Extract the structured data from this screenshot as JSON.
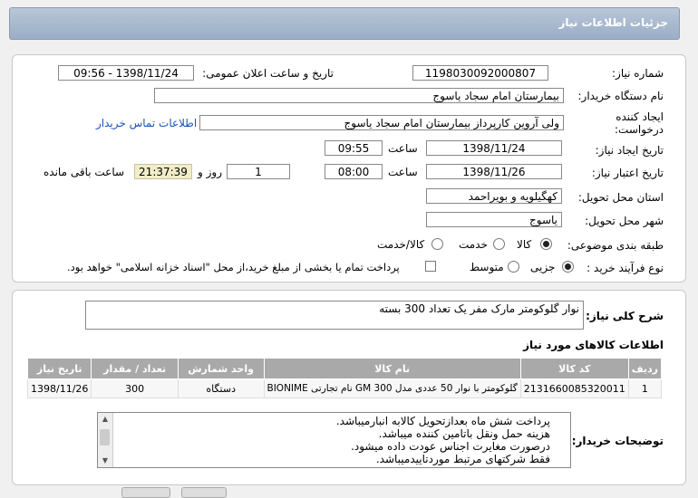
{
  "header": {
    "title": "جزئیات اطلاعات نیاز"
  },
  "form": {
    "need_number_label": "شماره نیاز:",
    "need_number": "1198030092000807",
    "announce_label": "تاریخ و ساعت اعلان عمومی:",
    "announce_value": "1398/11/24 - 09:56",
    "buyer_label": "نام دستگاه خریدار:",
    "buyer": "بیمارستان امام سجاد یاسوج",
    "creator_label": "ایجاد کننده درخواست:",
    "creator": "ولی آروین کارپرداز بیمارستان امام سجاد یاسوج",
    "contact_link": "اطلاعات تماس خریدار",
    "created_date_label": "تاریخ ایجاد نیاز:",
    "created_date": "1398/11/24",
    "time_label": "ساعت",
    "created_time": "09:55",
    "validity_label": "تاریخ اعتبار نیاز:",
    "validity_date": "1398/11/26",
    "validity_time": "08:00",
    "days": "1",
    "days_label": "روز و",
    "remaining": "21:37:39",
    "remaining_label": "ساعت باقی مانده",
    "province_label": "استان محل تحویل:",
    "province": "کهگیلویه و بویراحمد",
    "city_label": "شهر محل تحویل:",
    "city": "یاسوج",
    "category_label": "طبقه بندی موضوعی:",
    "category_options": [
      "کالا",
      "خدمت",
      "کالا/خدمت"
    ],
    "purchase_label": "نوع فرآیند خرید :",
    "purchase_options": [
      "جزیی",
      "متوسط"
    ],
    "payment_note": "پرداخت تمام یا بخشی از مبلغ خرید،از محل \"اسناد خزانه اسلامی\" خواهد بود."
  },
  "description": {
    "label": "شرح کلی نیاز:",
    "value": "نوار گلوکومتر مارک مفر یک تعداد 300 بسته"
  },
  "items": {
    "section_title": "اطلاعات کالاهای مورد نیاز",
    "headers": [
      "ردیف",
      "کد کالا",
      "نام کالا",
      "واحد شمارش",
      "تعداد / مقدار",
      "تاریخ نیاز"
    ],
    "rows": [
      [
        "1",
        "2131660085320011",
        "گلوکومتر با نوار 50 عددی مدل GM 300 نام تجارتی BIONIME",
        "دستگاه",
        "300",
        "1398/11/26"
      ]
    ]
  },
  "notes": {
    "label": "توضیحات خریدار:",
    "lines": [
      "پرداخت شش ماه بعدازتحویل کالابه انبارمیباشد.",
      "هزینه حمل ونقل باتامین کننده میباشد.",
      "درصورت مغایرت اجناس عودت داده میشود.",
      "فقط شرکتهای مرتبط موردتاییدمیباشد."
    ]
  }
}
